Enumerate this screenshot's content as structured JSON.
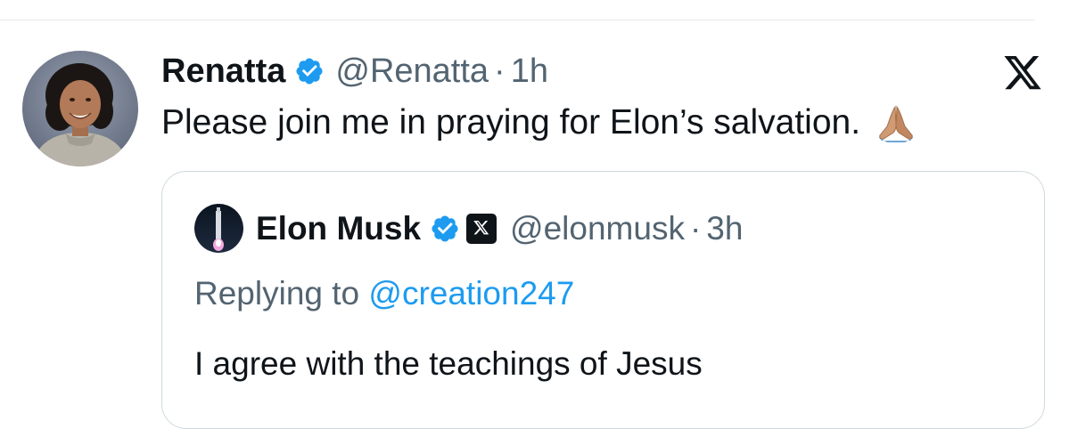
{
  "colors": {
    "text_primary": "#0f1419",
    "text_secondary": "#536471",
    "verified_blue": "#1d9bf0",
    "link_blue": "#1d9bf0",
    "border": "#cfd9de"
  },
  "tweet": {
    "author_name": "Renatta",
    "author_handle": "@Renatta",
    "separator": "·",
    "time": "1h",
    "verified_icon": "verified-badge-icon",
    "text": "Please join me in praying for Elon’s salvation.",
    "emoji": "folded-hands-emoji",
    "platform_icon": "x-logo-icon"
  },
  "quoted_tweet": {
    "author_name": "Elon Musk",
    "author_handle": "@elonmusk",
    "separator": "·",
    "time": "3h",
    "verified_icon": "verified-badge-icon",
    "affiliate_icon": "x-affiliate-badge-icon",
    "replying_label": "Replying to",
    "replying_to": "@creation247",
    "text": "I agree with the teachings of Jesus"
  }
}
